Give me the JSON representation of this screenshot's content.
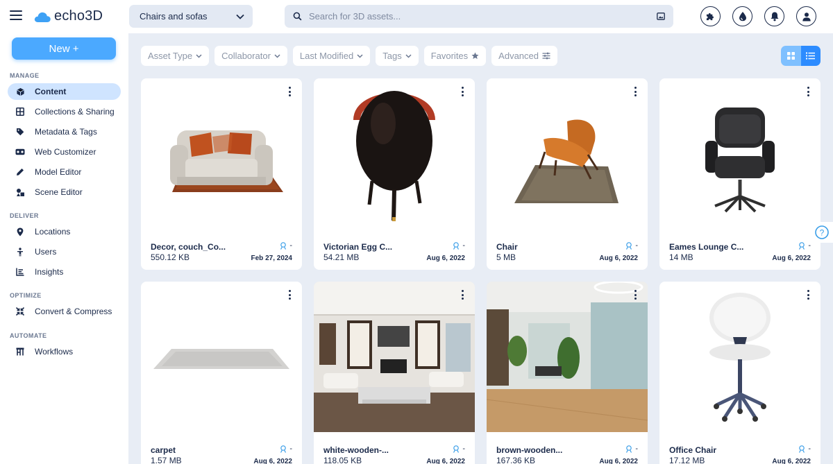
{
  "brand": {
    "name": "echo3D",
    "accent": "#4ba9ff",
    "dark": "#1b2a4a"
  },
  "header": {
    "project": "Chairs and sofas",
    "search_placeholder": "Search for 3D assets..."
  },
  "top_icons": [
    "puzzle-icon",
    "drop-icon",
    "bell-icon",
    "user-icon"
  ],
  "sidebar": {
    "new_button": "New +",
    "sections": [
      {
        "label": "MANAGE",
        "items": [
          "Content",
          "Collections & Sharing",
          "Metadata & Tags",
          "Web Customizer",
          "Model Editor",
          "Scene Editor"
        ]
      },
      {
        "label": "DELIVER",
        "items": [
          "Locations",
          "Users",
          "Insights"
        ]
      },
      {
        "label": "OPTIMIZE",
        "items": [
          "Convert & Compress"
        ]
      },
      {
        "label": "AUTOMATE",
        "items": [
          "Workflows"
        ]
      }
    ],
    "active": "Content"
  },
  "filters": [
    "Asset Type",
    "Collaborator",
    "Last Modified",
    "Tags",
    "Favorites",
    "Advanced"
  ],
  "assets": [
    {
      "name": "Decor, couch_Co...",
      "size": "550.12 KB",
      "date": "Feb 27, 2024",
      "collab": "-"
    },
    {
      "name": "Victorian Egg C...",
      "size": "54.21 MB",
      "date": "Aug 6, 2022",
      "collab": "-"
    },
    {
      "name": "Chair",
      "size": "5 MB",
      "date": "Aug 6, 2022",
      "collab": "-"
    },
    {
      "name": "Eames Lounge C...",
      "size": "14 MB",
      "date": "Aug 6, 2022",
      "collab": "-"
    },
    {
      "name": "carpet",
      "size": "1.57 MB",
      "date": "Aug 6, 2022",
      "collab": "-"
    },
    {
      "name": "white-wooden-...",
      "size": "118.05 KB",
      "date": "Aug 6, 2022",
      "collab": "-"
    },
    {
      "name": "brown-wooden...",
      "size": "167.36 KB",
      "date": "Aug 6, 2022",
      "collab": "-"
    },
    {
      "name": "Office Chair",
      "size": "17.12 MB",
      "date": "Aug 6, 2022",
      "collab": "-"
    }
  ],
  "help": "?"
}
